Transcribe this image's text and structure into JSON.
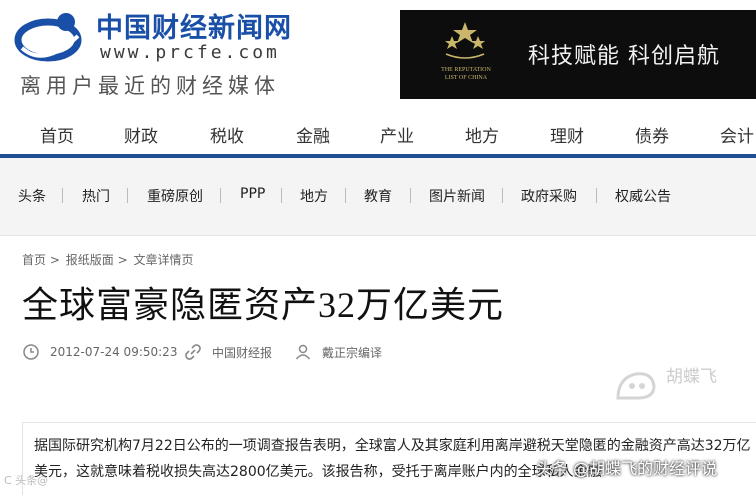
{
  "header": {
    "site_name": "中国财经新闻网",
    "site_url": "www.prcfe.com",
    "slogan": "离用户最近的财经媒体",
    "banner": {
      "emblem_text": "THE REPUTATION\nLIST OF CHINA",
      "slogan": "科技赋能 科创启航"
    }
  },
  "main_nav": {
    "items": [
      "首页",
      "财政",
      "税收",
      "金融",
      "产业",
      "地方",
      "理财",
      "债券",
      "会计"
    ]
  },
  "sub_nav": {
    "items": [
      "头条",
      "热门",
      "重磅原创",
      "PPP",
      "地方",
      "教育",
      "图片新闻",
      "政府采购",
      "权威公告"
    ]
  },
  "breadcrumb": {
    "items": [
      "首页",
      "报纸版面",
      "文章详情页"
    ],
    "separator": ">"
  },
  "article": {
    "title": "全球富豪隐匿资产32万亿美元",
    "datetime": "2012-07-24 09:50:23",
    "source": "中国财经报",
    "author": "戴正宗编译",
    "body_line1": "据国际研究机构7月22日公布的一项调查报告表明，全球富人及其家庭利用离岸避税天堂隐匿的金融资产高达32万亿",
    "body_line2": "美元，这就意味着税收损失高达2800亿美元。该报告称，受托于离岸账户内的全球私人金融"
  },
  "watermarks": {
    "left": "C 头条@",
    "right_bottom": "头条 @胡蝶飞的财经评说",
    "right_top": "胡蝶飞"
  },
  "colors": {
    "brand_blue": "#1a4fa8",
    "nav_rule": "#1e4f95",
    "banner_bg": "#0d0d0d",
    "banner_gold": "#c9b66a"
  },
  "icons": {
    "clock": "clock-icon",
    "link": "link-icon",
    "user": "user-icon"
  }
}
